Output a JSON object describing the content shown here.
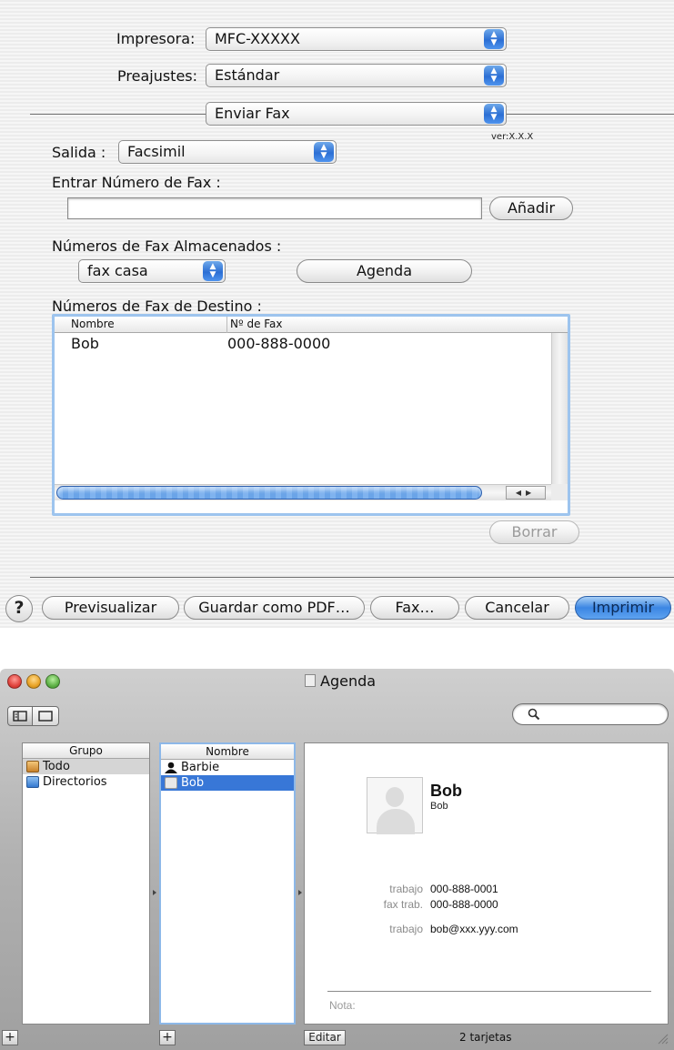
{
  "print_dialog": {
    "printer": {
      "label": "Impresora:",
      "value": "MFC-XXXXX"
    },
    "presets": {
      "label": "Preajustes:",
      "value": "Estándar"
    },
    "panel": {
      "value": "Enviar Fax"
    },
    "version": "ver:X.X.X",
    "output": {
      "label": "Salida :",
      "value": "Facsimil"
    },
    "fax_number": {
      "label": "Entrar Número de Fax :",
      "value": "",
      "add_button": "Añadir"
    },
    "stored_numbers": {
      "label": "Números de Fax Almacenados :",
      "value": "fax casa",
      "address_book_button": "Agenda"
    },
    "destination": {
      "label": "Números de Fax de Destino :",
      "columns": [
        "Nombre",
        "Nº de Fax"
      ],
      "rows": [
        {
          "name": "Bob",
          "fax": "000-888-0000"
        }
      ]
    },
    "delete_button": "Borrar",
    "buttons": {
      "help": "?",
      "preview": "Previsualizar",
      "save_pdf": "Guardar como PDF…",
      "fax": "Fax…",
      "cancel": "Cancelar",
      "print": "Imprimir"
    }
  },
  "agenda": {
    "title": "Agenda",
    "groups": {
      "header": "Grupo",
      "items": [
        "Todo",
        "Directorios"
      ]
    },
    "names": {
      "header": "Nombre",
      "items": [
        "Barbie",
        "Bob"
      ]
    },
    "card": {
      "name": "Bob",
      "subtitle": "Bob",
      "fields": [
        {
          "label": "trabajo",
          "value": "000-888-0001"
        },
        {
          "label": "fax trab.",
          "value": "000-888-0000"
        },
        {
          "label": "trabajo",
          "value": "bob@xxx.yyy.com"
        }
      ],
      "note_label": "Nota:"
    },
    "edit_button": "Editar",
    "card_count": "2 tarjetas",
    "add_glyph": "+"
  },
  "colors": {
    "accent_blue": "#3877d7",
    "default_button": "#3c86e3",
    "close": "#e0443e",
    "minimize": "#e8a327",
    "zoom": "#5fb147"
  }
}
